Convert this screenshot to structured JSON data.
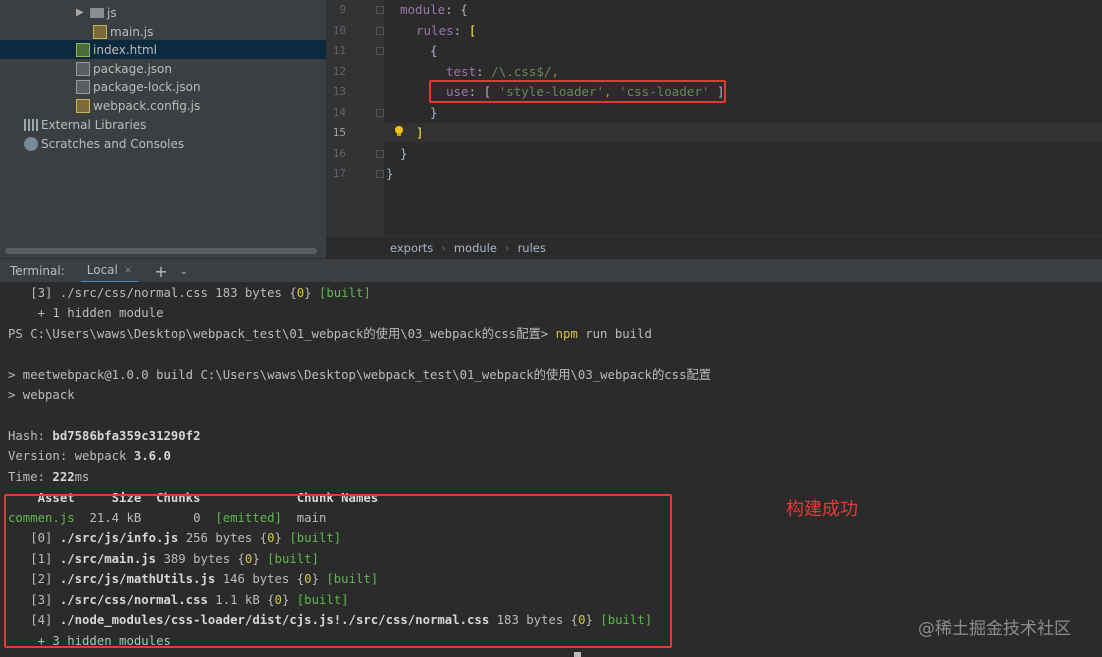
{
  "project_tree": {
    "items": [
      {
        "label": "js",
        "icon": "folder-icon"
      },
      {
        "label": "main.js",
        "icon": "js-file-icon"
      },
      {
        "label": "index.html",
        "icon": "html-file-icon",
        "selected": true
      },
      {
        "label": "package.json",
        "icon": "json-file-icon"
      },
      {
        "label": "package-lock.json",
        "icon": "json-file-icon"
      },
      {
        "label": "webpack.config.js",
        "icon": "js-file-icon"
      },
      {
        "label": "External Libraries",
        "icon": "library-icon"
      },
      {
        "label": "Scratches and Consoles",
        "icon": "scratches-icon"
      }
    ]
  },
  "editor": {
    "line_numbers": [
      "9",
      "10",
      "11",
      "12",
      "13",
      "14",
      "15",
      "16",
      "17"
    ],
    "current_line": "15",
    "lines": {
      "l9_key": "module",
      "l9_rest": ": {",
      "l10_key": "rules",
      "l10_rest": ": ",
      "l10_bracket": "[",
      "l11": "{",
      "l12_key": "test",
      "l12_colon": ": ",
      "l12_regex": "/\\.css$/",
      "l12_comma": ",",
      "l13_key": "use",
      "l13_open": ": [ ",
      "l13_s1": "'style-loader'",
      "l13_comma": ", ",
      "l13_s2": "'css-loader'",
      "l13_close": " ]",
      "l14": "}",
      "l15_bracket": "]",
      "l16": "}",
      "l17": "}"
    },
    "breadcrumb": [
      "exports",
      "module",
      "rules"
    ]
  },
  "terminal_header": {
    "title": "Terminal:",
    "tab_label": "Local",
    "close": "×",
    "add": "+",
    "more": "⌄"
  },
  "terminal": {
    "line1_a": "   [3] ./src/css/normal.css 183 bytes {",
    "line1_b": "0",
    "line1_c": "} ",
    "line1_d": "[built]",
    "line2": "    + 1 hidden module",
    "line3_a": "PS C:\\Users\\waws\\Desktop\\webpack_test\\01_webpack的使用\\03_webpack的css配置> ",
    "line3_b": "npm",
    "line3_c": " run build",
    "line5": "> meetwebpack@1.0.0 build C:\\Users\\waws\\Desktop\\webpack_test\\01_webpack的使用\\03_webpack的css配置",
    "line6": "> webpack",
    "hash_label": "Hash: ",
    "hash_value": "bd7586bfa359c31290f2",
    "version_label": "Version: webpack ",
    "version_value": "3.6.0",
    "time_label": "Time: ",
    "time_value": "222",
    "time_unit": "ms",
    "header_row": "    Asset     Size  Chunks             Chunk Names",
    "asset_name": "commen.js",
    "asset_size": "  21.4 kB       0  ",
    "asset_emitted": "[emitted]",
    "asset_chunk": "  main",
    "modules": [
      {
        "prefix": "   [0] ",
        "path": "./src/js/info.js",
        "size": " 256 bytes {",
        "chunk": "0",
        "end": "} ",
        "status": "[built]"
      },
      {
        "prefix": "   [1] ",
        "path": "./src/main.js",
        "size": " 389 bytes {",
        "chunk": "0",
        "end": "} ",
        "status": "[built]"
      },
      {
        "prefix": "   [2] ",
        "path": "./src/js/mathUtils.js",
        "size": " 146 bytes {",
        "chunk": "0",
        "end": "} ",
        "status": "[built]"
      },
      {
        "prefix": "   [3] ",
        "path": "./src/css/normal.css",
        "size": " 1.1 kB {",
        "chunk": "0",
        "end": "} ",
        "status": "[built]"
      },
      {
        "prefix": "   [4] ",
        "path": "./node_modules/css-loader/dist/cjs.js!./src/css/normal.css",
        "size": " 183 bytes {",
        "chunk": "0",
        "end": "} ",
        "status": "[built]"
      }
    ],
    "hidden_modules": "    + 3 hidden modules"
  },
  "annotation": "构建成功",
  "watermark": "@稀土掘金技术社区",
  "colors": {
    "highlight_box": "#e53935",
    "success_green": "#5fb650",
    "chunk_yellow": "#d5c545"
  }
}
